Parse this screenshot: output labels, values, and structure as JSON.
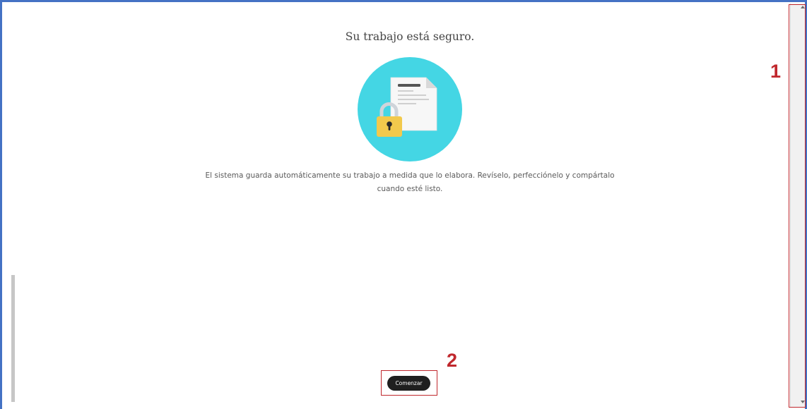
{
  "main": {
    "title": "Su trabajo está seguro.",
    "description": "El sistema guarda automáticamente su trabajo a medida que lo elabora. Revíselo, perfecciónelo y compártalo cuando esté listo.",
    "start_button_label": "Comenzar",
    "illustration": {
      "icon": "secure-document-lock-icon",
      "circle_color": "#44d6e4",
      "lock_color": "#f2c94c"
    }
  },
  "annotations": {
    "marker_1": "1",
    "marker_2": "2",
    "color": "#c0282d"
  },
  "frame_color": "#4472c4"
}
